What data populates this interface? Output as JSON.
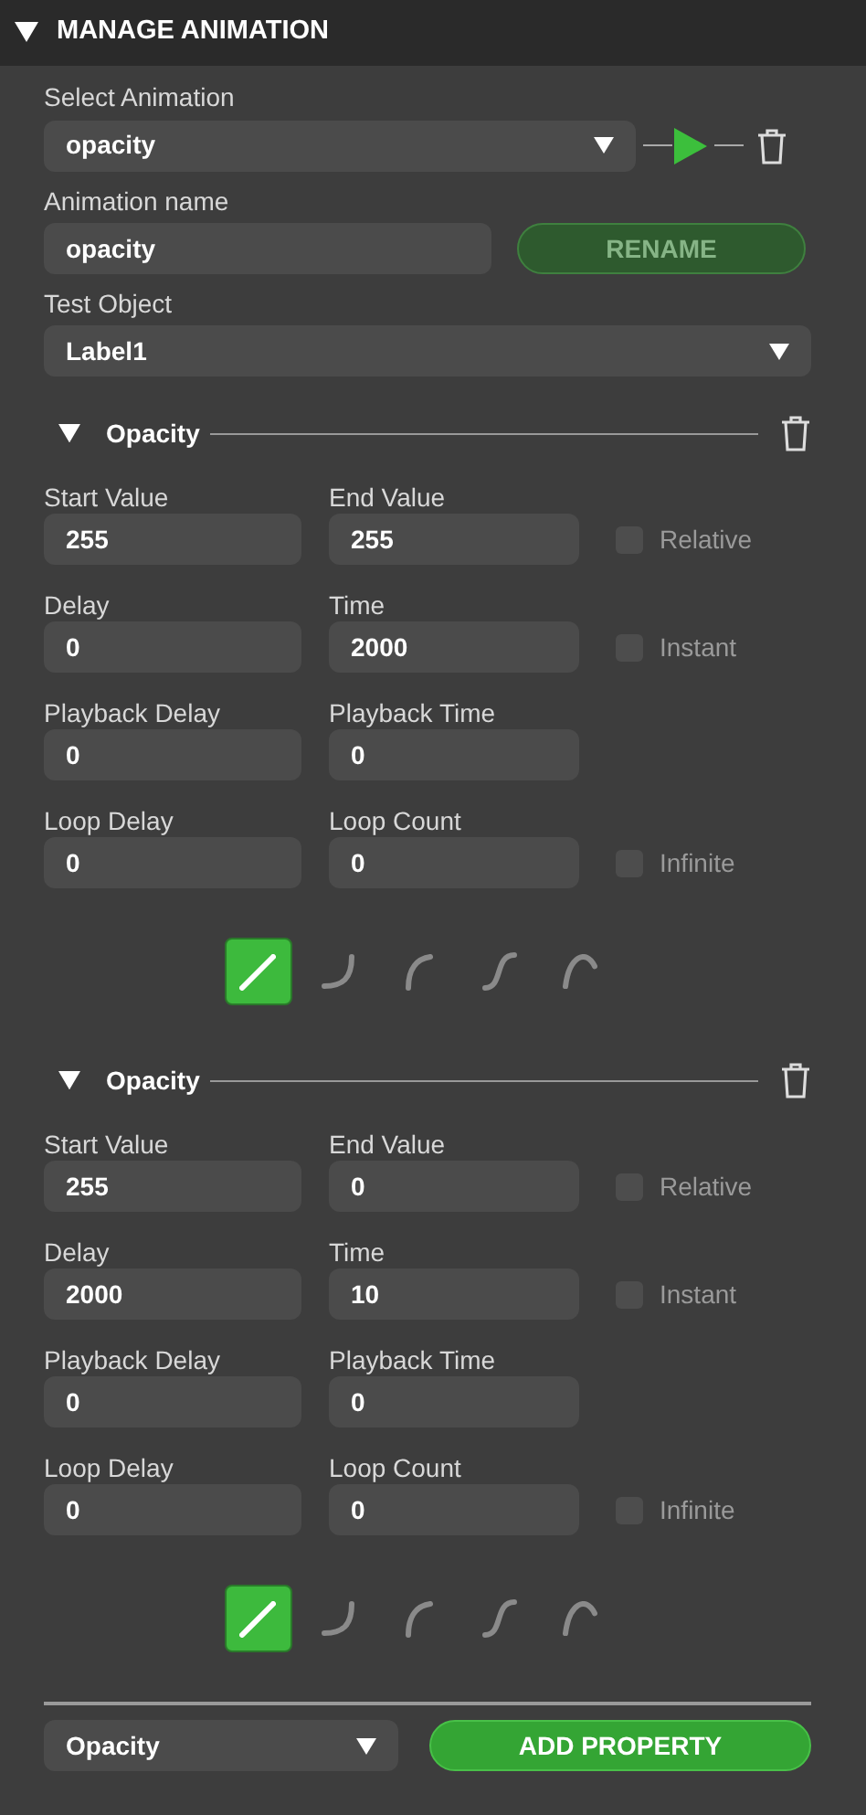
{
  "panel": {
    "title": "MANAGE ANIMATION",
    "expanded": true
  },
  "select_animation": {
    "label": "Select Animation",
    "value": "opacity"
  },
  "animation_name": {
    "label": "Animation name",
    "value": "opacity"
  },
  "rename_button": {
    "label": "RENAME",
    "disabled": true
  },
  "test_object": {
    "label": "Test Object",
    "value": "Label1"
  },
  "properties": [
    {
      "title": "Opacity",
      "expanded": true,
      "rows": [
        {
          "fields": [
            {
              "label": "Start Value",
              "value": "255"
            },
            {
              "label": "End Value",
              "value": "255"
            }
          ],
          "checkbox": {
            "label": "Relative",
            "checked": false
          }
        },
        {
          "fields": [
            {
              "label": "Delay",
              "value": "0"
            },
            {
              "label": "Time",
              "value": "2000"
            }
          ],
          "checkbox": {
            "label": "Instant",
            "checked": false
          }
        },
        {
          "fields": [
            {
              "label": "Playback Delay",
              "value": "0"
            },
            {
              "label": "Playback Time",
              "value": "0"
            }
          ]
        },
        {
          "fields": [
            {
              "label": "Loop Delay",
              "value": "0"
            },
            {
              "label": "Loop Count",
              "value": "0"
            }
          ],
          "checkbox": {
            "label": "Infinite",
            "checked": false
          }
        }
      ],
      "easings": [
        {
          "kind": "linear",
          "selected": true
        },
        {
          "kind": "ease-in",
          "selected": false
        },
        {
          "kind": "ease-out",
          "selected": false
        },
        {
          "kind": "ease-in-out",
          "selected": false
        },
        {
          "kind": "overshoot",
          "selected": false
        }
      ]
    },
    {
      "title": "Opacity",
      "expanded": true,
      "rows": [
        {
          "fields": [
            {
              "label": "Start Value",
              "value": "255"
            },
            {
              "label": "End Value",
              "value": "0"
            }
          ],
          "checkbox": {
            "label": "Relative",
            "checked": false
          }
        },
        {
          "fields": [
            {
              "label": "Delay",
              "value": "2000"
            },
            {
              "label": "Time",
              "value": "10"
            }
          ],
          "checkbox": {
            "label": "Instant",
            "checked": false
          }
        },
        {
          "fields": [
            {
              "label": "Playback Delay",
              "value": "0"
            },
            {
              "label": "Playback Time",
              "value": "0"
            }
          ]
        },
        {
          "fields": [
            {
              "label": "Loop Delay",
              "value": "0"
            },
            {
              "label": "Loop Count",
              "value": "0"
            }
          ],
          "checkbox": {
            "label": "Infinite",
            "checked": false
          }
        }
      ],
      "easings": [
        {
          "kind": "linear",
          "selected": true
        },
        {
          "kind": "ease-in",
          "selected": false
        },
        {
          "kind": "ease-out",
          "selected": false
        },
        {
          "kind": "ease-in-out",
          "selected": false
        },
        {
          "kind": "overshoot",
          "selected": false
        }
      ]
    }
  ],
  "add_property": {
    "value": "Opacity",
    "button": "ADD PROPERTY"
  }
}
